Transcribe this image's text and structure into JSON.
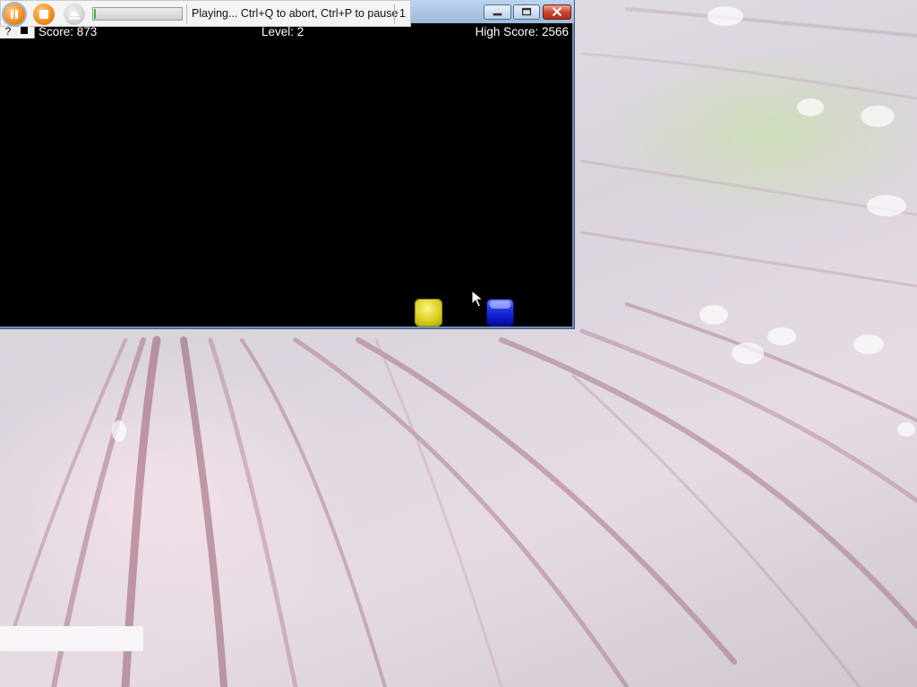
{
  "game": {
    "score_text": "Score: 873",
    "level_text": "Level: 2",
    "high_score_text": "High Score: 2566",
    "help_label": "?",
    "blocks": [
      {
        "color": "#e0d51e",
        "name": "yellow"
      },
      {
        "color": "#1020e0",
        "name": "blue"
      }
    ]
  },
  "window": {
    "buttons": [
      {
        "name": "minimize",
        "icon": "minimize-icon"
      },
      {
        "name": "maximize",
        "icon": "maximize-icon"
      },
      {
        "name": "close",
        "icon": "close-icon"
      }
    ]
  },
  "recorder": {
    "status": "Playing... Ctrl+Q to abort, Ctrl+P to pause",
    "counter": "1",
    "progress": 0.02,
    "buttons": [
      {
        "name": "pause",
        "icon": "pause-icon",
        "color": "#f08a1c"
      },
      {
        "name": "stop",
        "icon": "stop-icon",
        "color": "#f08a1c"
      },
      {
        "name": "eject",
        "icon": "eject-icon",
        "color": "#cfcfcf"
      }
    ]
  },
  "colors": {
    "game_background": "#000000",
    "hud_text": "#ffffff",
    "titlebar": "#a9c4e4"
  }
}
